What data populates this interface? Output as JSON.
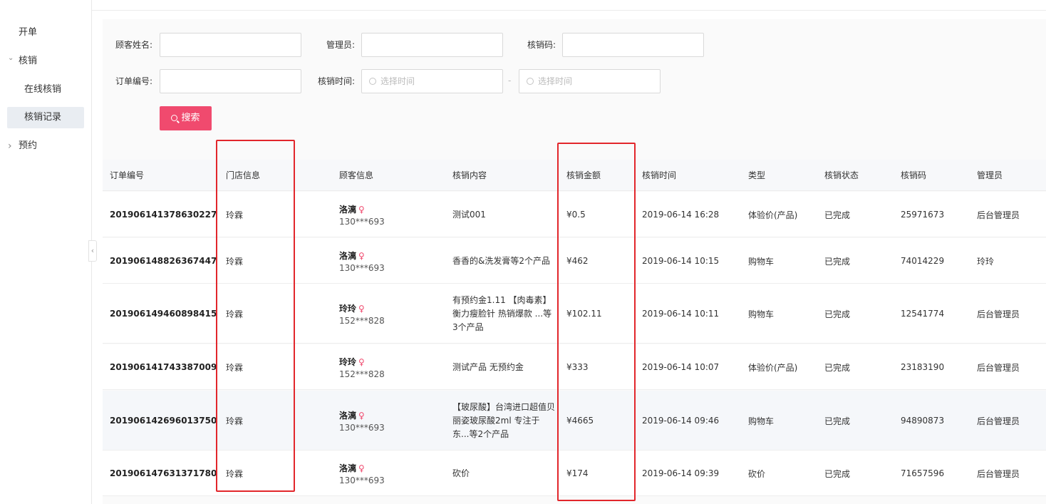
{
  "sidebar": {
    "kaidan": "开单",
    "hexiao": "核销",
    "online": "在线核销",
    "records": "核销记录",
    "yuyue": "预约",
    "arrow_down": "⌄",
    "arrow_right": "›",
    "collapse": "‹"
  },
  "filters": {
    "customer_label": "顾客姓名:",
    "admin_label": "管理员:",
    "code_label": "核销码:",
    "order_label": "订单编号:",
    "time_label": "核销时间:",
    "start_placeholder": "选择时间",
    "end_placeholder": "选择时间",
    "range_dash": "-",
    "search_label": "搜索"
  },
  "table": {
    "columns": [
      "订单编号",
      "门店信息",
      "顾客信息",
      "核销内容",
      "核销金额",
      "核销时间",
      "类型",
      "核销状态",
      "核销码",
      "管理员"
    ],
    "gender_symbol": "♀",
    "rows": [
      {
        "order": "201906141378630227",
        "store": "玲霖",
        "name": "洛漓",
        "phone": "130***693",
        "content": "测试001",
        "amount": "¥0.5",
        "time": "2019-06-14 16:28",
        "type": "体验价(产品)",
        "status": "已完成",
        "code": "25971673",
        "admin": "后台管理员"
      },
      {
        "order": "201906148826367447",
        "store": "玲霖",
        "name": "洛漓",
        "phone": "130***693",
        "content": "香香的&洗发膏等2个产品",
        "amount": "¥462",
        "time": "2019-06-14 10:15",
        "type": "购物车",
        "status": "已完成",
        "code": "74014229",
        "admin": "玲玲"
      },
      {
        "order": "201906149460898415",
        "store": "玲霖",
        "name": "玲玲",
        "phone": "152***828",
        "content": "有预约金1.11 【肉毒素】衡力瘦脸针 热销爆款 ...等3个产品",
        "amount": "¥102.11",
        "time": "2019-06-14 10:11",
        "type": "购物车",
        "status": "已完成",
        "code": "12541774",
        "admin": "后台管理员"
      },
      {
        "order": "201906141743387009",
        "store": "玲霖",
        "name": "玲玲",
        "phone": "152***828",
        "content": "测试产品 无预约金",
        "amount": "¥333",
        "time": "2019-06-14 10:07",
        "type": "体验价(产品)",
        "status": "已完成",
        "code": "23183190",
        "admin": "后台管理员"
      },
      {
        "order": "201906142696013750",
        "store": "玲霖",
        "name": "洛漓",
        "phone": "130***693",
        "content": "【玻尿酸】台湾进口超值贝丽姿玻尿酸2ml 专注于东...等2个产品",
        "amount": "¥4665",
        "time": "2019-06-14 09:46",
        "type": "购物车",
        "status": "已完成",
        "code": "94890873",
        "admin": "后台管理员"
      },
      {
        "order": "201906147631371780",
        "store": "玲霖",
        "name": "洛漓",
        "phone": "130***693",
        "content": "砍价",
        "amount": "¥174",
        "time": "2019-06-14 09:39",
        "type": "砍价",
        "status": "已完成",
        "code": "71657596",
        "admin": "后台管理员"
      }
    ]
  },
  "colors": {
    "accent": "#f04a6e",
    "highlight_box": "#e2262b"
  }
}
